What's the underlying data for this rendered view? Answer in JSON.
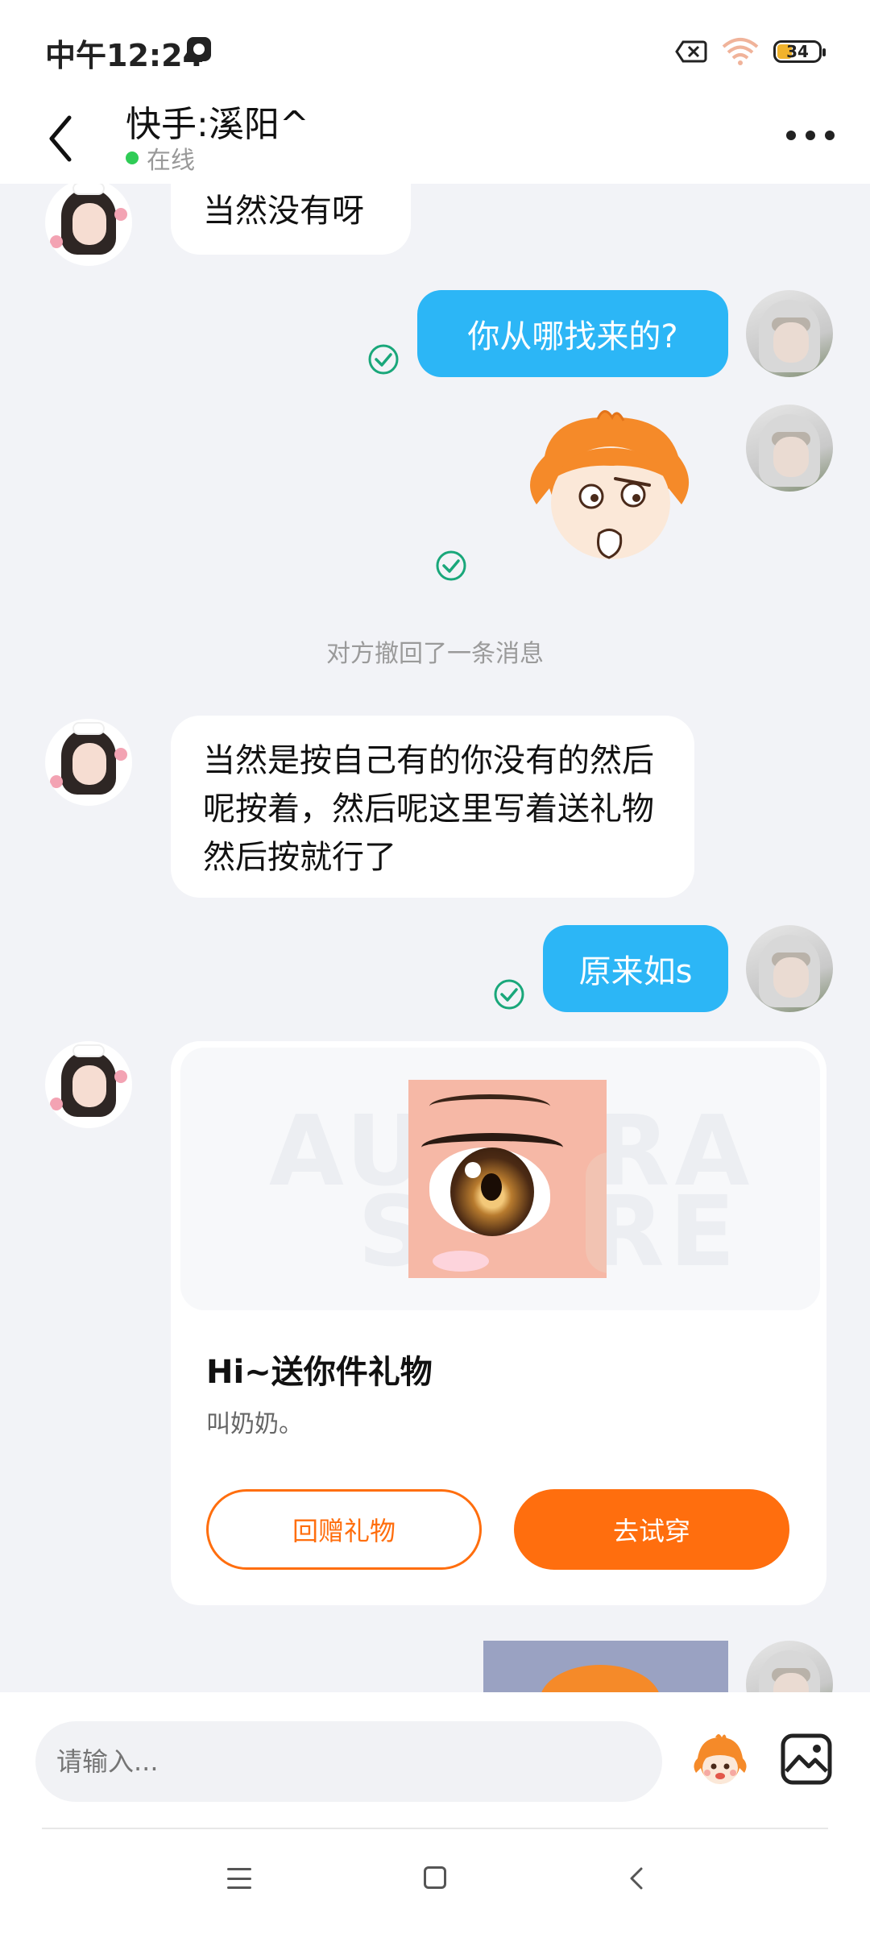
{
  "status_bar": {
    "time": "中午12:24",
    "battery": "34"
  },
  "header": {
    "title": "快手:溪阳^",
    "status": "在线"
  },
  "messages": {
    "partial_top": "当然没有呀",
    "out_1": "你从哪找来的?",
    "recall_notice": "对方撤回了一条消息",
    "in_long": "当然是按自己有的你没有的然后呢按着，然后呢这里写着送礼物然后按就行了",
    "out_2": "原来如s"
  },
  "gift_card": {
    "watermark_1": "AURORA",
    "watermark_2": "STORE",
    "title": "Hi~送你件礼物",
    "subtitle": "叫奶奶。",
    "return_gift_label": "回赠礼物",
    "try_on_label": "去试穿"
  },
  "input": {
    "placeholder": "请输入..."
  },
  "colors": {
    "accent_blue": "#2cb6f6",
    "accent_orange": "#ff6e0e",
    "read_green": "#19a77a",
    "online_green": "#2fcc56"
  }
}
